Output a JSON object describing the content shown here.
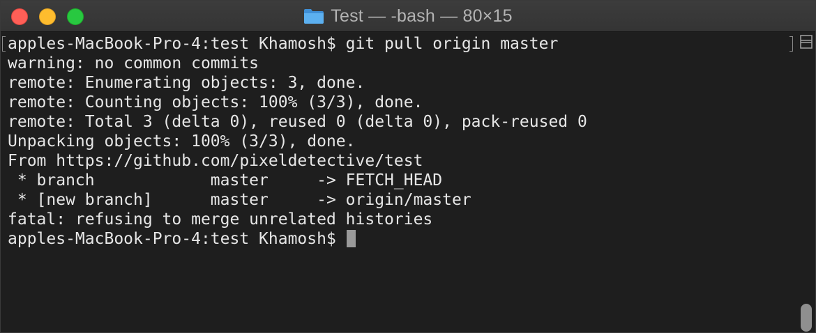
{
  "window": {
    "title": "Test — -bash — 80×15",
    "icons": {
      "close": "close-icon",
      "minimize": "minimize-icon",
      "zoom": "zoom-icon",
      "folder": "folder-icon",
      "split": "split-pane-icon"
    },
    "colors": {
      "background": "#1e1e1e",
      "text": "#e6e6e6",
      "titlebar": "#383838",
      "title_text": "#b3b3b3",
      "close": "#ff5f57",
      "minimize": "#febc2e",
      "zoom": "#28c840",
      "folder": "#4ea1e6"
    }
  },
  "terminal": {
    "lines": [
      "apples-MacBook-Pro-4:test Khamosh$ git pull origin master",
      "warning: no common commits",
      "remote: Enumerating objects: 3, done.",
      "remote: Counting objects: 100% (3/3), done.",
      "remote: Total 3 (delta 0), reused 0 (delta 0), pack-reused 0",
      "Unpacking objects: 100% (3/3), done.",
      "From https://github.com/pixeldetective/test",
      " * branch            master     -> FETCH_HEAD",
      " * [new branch]      master     -> origin/master",
      "fatal: refusing to merge unrelated histories"
    ],
    "prompt": "apples-MacBook-Pro-4:test Khamosh$ "
  }
}
